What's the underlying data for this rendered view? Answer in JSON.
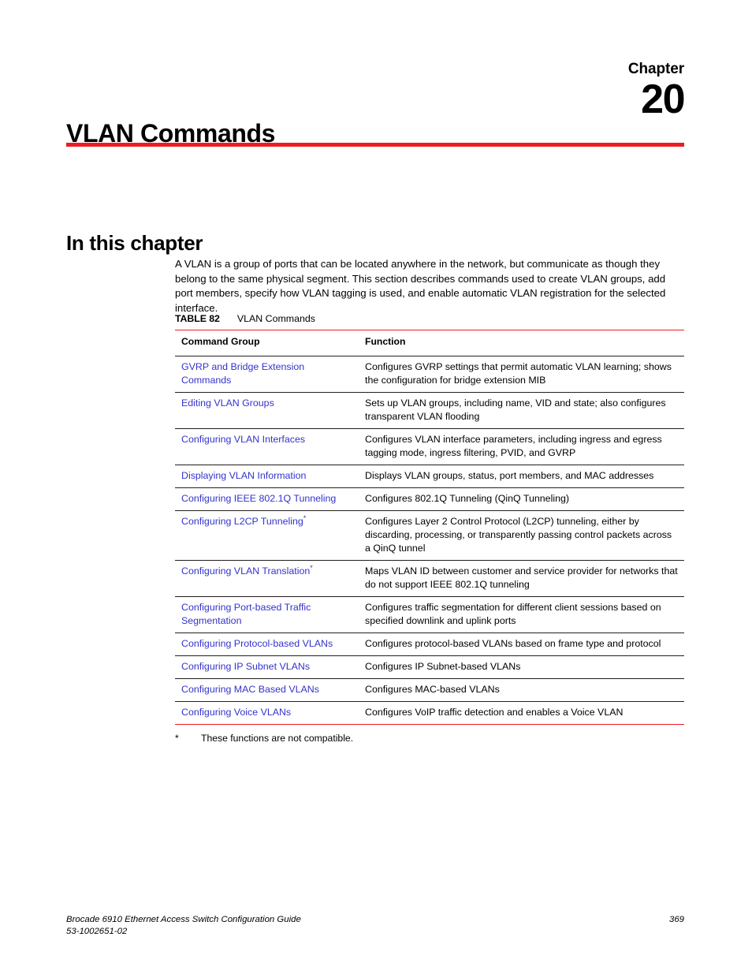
{
  "header": {
    "chapter_word": "Chapter",
    "chapter_number": "20",
    "chapter_title": "VLAN Commands"
  },
  "section": {
    "heading": "In this chapter",
    "intro": "A VLAN is a group of ports that can be located anywhere in the network, but communicate as though they belong to the same physical segment. This section describes commands used to create VLAN groups, add port members, specify how VLAN tagging is used, and enable automatic VLAN registration for the selected interface."
  },
  "table": {
    "label": "TABLE 82",
    "title": "VLAN Commands",
    "columns": [
      "Command Group",
      "Function"
    ],
    "rows": [
      {
        "group": "GVRP and Bridge Extension Commands",
        "footnote": "",
        "function": "Configures GVRP settings that permit automatic VLAN learning; shows the configuration for bridge extension MIB"
      },
      {
        "group": "Editing VLAN Groups",
        "footnote": "",
        "function": "Sets up VLAN groups, including name, VID and state; also configures transparent VLAN flooding"
      },
      {
        "group": "Configuring VLAN Interfaces",
        "footnote": "",
        "function": "Configures VLAN interface parameters, including ingress and egress tagging mode, ingress filtering, PVID, and GVRP"
      },
      {
        "group": "Displaying VLAN Information",
        "footnote": "",
        "function": "Displays VLAN groups, status, port members, and MAC addresses"
      },
      {
        "group": "Configuring IEEE 802.1Q Tunneling",
        "footnote": "",
        "function": "Configures 802.1Q Tunneling (QinQ Tunneling)"
      },
      {
        "group": "Configuring L2CP Tunneling",
        "footnote": "*",
        "function": "Configures Layer 2 Control Protocol (L2CP) tunneling, either by discarding, processing, or transparently passing control packets across a QinQ tunnel"
      },
      {
        "group": "Configuring VLAN Translation",
        "footnote": "*",
        "function": "Maps VLAN ID between customer and service provider for networks that do not support IEEE 802.1Q tunneling"
      },
      {
        "group": "Configuring Port-based Traffic Segmentation",
        "footnote": "",
        "function": "Configures traffic segmentation for different client sessions based on specified downlink and uplink ports"
      },
      {
        "group": "Configuring Protocol-based VLANs",
        "footnote": "",
        "function": "Configures protocol-based VLANs based on frame type and protocol"
      },
      {
        "group": "Configuring IP Subnet VLANs",
        "footnote": "",
        "function": "Configures IP Subnet-based VLANs"
      },
      {
        "group": "Configuring MAC Based VLANs",
        "footnote": "",
        "function": "Configures MAC-based VLANs"
      },
      {
        "group": "Configuring Voice VLANs",
        "footnote": "",
        "function": "Configures VoIP traffic detection and enables a Voice VLAN"
      }
    ],
    "footnote_marker": "*",
    "footnote_text": "These functions are not compatible."
  },
  "footer": {
    "guide_title": "Brocade 6910 Ethernet Access Switch Configuration Guide",
    "doc_number": "53-1002651-02",
    "page_number": "369"
  },
  "colors": {
    "rule_red": "#ed1c24",
    "link_blue": "#3333cc",
    "text_black": "#000000"
  }
}
